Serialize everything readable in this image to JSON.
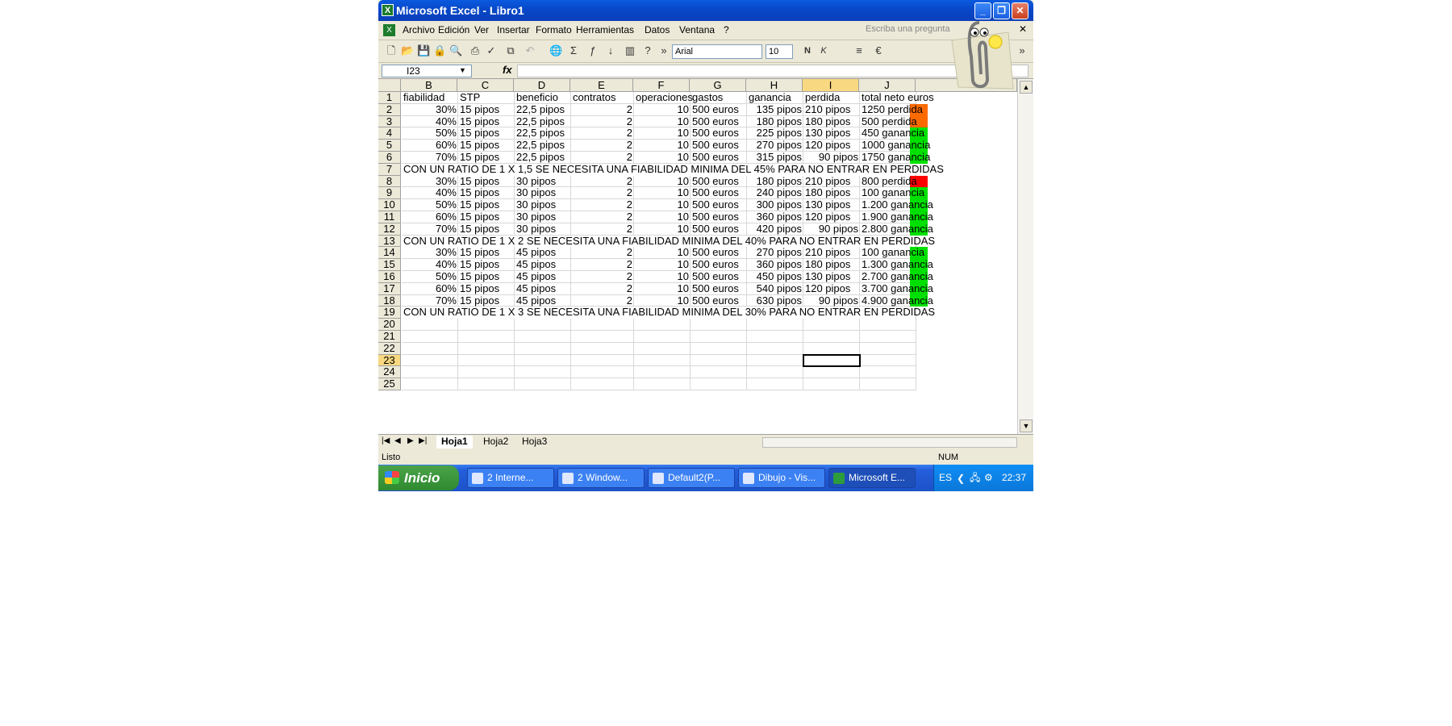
{
  "window": {
    "title": "Microsoft Excel - Libro1"
  },
  "menu": {
    "items": [
      "Archivo",
      "Edición",
      "Ver",
      "Insertar",
      "Formato",
      "Herramientas",
      "Datos",
      "Ventana",
      "?"
    ],
    "ask_placeholder": "Escriba una pregunta"
  },
  "toolbar": {
    "font": "Arial",
    "size": "10",
    "bold": "N",
    "italic": "K"
  },
  "formula": {
    "namebox": "I23",
    "fx": "fx"
  },
  "columns": [
    "B",
    "C",
    "D",
    "E",
    "F",
    "G",
    "H",
    "I",
    "J"
  ],
  "rows_numbers": [
    "1",
    "2",
    "3",
    "4",
    "5",
    "6",
    "7",
    "8",
    "9",
    "10",
    "11",
    "12",
    "13",
    "14",
    "15",
    "16",
    "17",
    "18",
    "19",
    "20",
    "21",
    "22",
    "23",
    "24",
    "25"
  ],
  "table": {
    "headers": [
      "fiabilidad",
      "STP",
      "beneficio",
      "contratos",
      "operaciones",
      "gastos",
      "ganancia",
      "perdida",
      "total neto euros"
    ],
    "rows": [
      [
        "30%",
        "15 pipos",
        "22,5 pipos",
        "2",
        "10",
        "500 euros",
        "135 pipos",
        "210 pipos",
        "1250  perdida"
      ],
      [
        "40%",
        "15 pipos",
        "22,5 pipos",
        "2",
        "10",
        "500 euros",
        "180 pipos",
        "180 pipos",
        "500   perdida"
      ],
      [
        "50%",
        "15 pipos",
        "22,5 pipos",
        "2",
        "10",
        "500 euros",
        "225 pipos",
        "130 pipos",
        "450 ganancia"
      ],
      [
        "60%",
        "15 pipos",
        "22,5 pipos",
        "2",
        "10",
        "500 euros",
        "270 pipos",
        "120 pipos",
        "1000 ganancia"
      ],
      [
        "70%",
        "15 pipos",
        "22,5 pipos",
        "2",
        "10",
        "500 euros",
        "315 pipos",
        "90 pipos",
        "1750 ganancia"
      ],
      [
        "30%",
        "15 pipos",
        "30 pipos",
        "2",
        "10",
        "500 euros",
        "180 pipos",
        "210 pipos",
        "800  perdida"
      ],
      [
        "40%",
        "15 pipos",
        "30 pipos",
        "2",
        "10",
        "500 euros",
        "240 pipos",
        "180 pipos",
        "100 ganancia"
      ],
      [
        "50%",
        "15 pipos",
        "30 pipos",
        "2",
        "10",
        "500 euros",
        "300 pipos",
        "130 pipos",
        "1.200 ganancia"
      ],
      [
        "60%",
        "15 pipos",
        "30 pipos",
        "2",
        "10",
        "500 euros",
        "360 pipos",
        "120 pipos",
        "1.900 ganancia"
      ],
      [
        "70%",
        "15 pipos",
        "30 pipos",
        "2",
        "10",
        "500 euros",
        "420 pipos",
        "90 pipos",
        "2.800 ganancia"
      ],
      [
        "30%",
        "15 pipos",
        "45 pipos",
        "2",
        "10",
        "500 euros",
        "270 pipos",
        "210 pipos",
        "100 ganancia"
      ],
      [
        "40%",
        "15 pipos",
        "45 pipos",
        "2",
        "10",
        "500 euros",
        "360 pipos",
        "180 pipos",
        "1.300 ganancia"
      ],
      [
        "50%",
        "15 pipos",
        "45 pipos",
        "2",
        "10",
        "500 euros",
        "450 pipos",
        "130 pipos",
        "2.700 ganancia"
      ],
      [
        "60%",
        "15 pipos",
        "45 pipos",
        "2",
        "10",
        "500 euros",
        "540 pipos",
        "120 pipos",
        "3.700 ganancia"
      ],
      [
        "70%",
        "15 pipos",
        "45 pipos",
        "2",
        "10",
        "500 euros",
        "630 pipos",
        "90 pipos",
        "4.900 ganancia"
      ]
    ],
    "notes": [
      "CON UN RATIO DE 1 X 1,5  SE NECESITA UNA FIABILIDAD MINIMA  DEL 45% PARA NO ENTRAR EN PERDIDAS",
      "CON UN RATIO DE 1  X  2   SE NECESITA UNA FIABILIDAD MINIMA DEL  40%  PARA NO ENTRAR EN PERDIDAS",
      "CON UN RATIO DE 1  X  3  SE NECESITA UNA FIABILIDAD  MINIMA DEL 30% PARA NO ENTRAR EN PERDIDAS"
    ],
    "status_colors": [
      "#ff6a00",
      "#ff6a00",
      "#00e000",
      "#00e000",
      "#00e000",
      "#ff0000",
      "#00e000",
      "#00e000",
      "#00e000",
      "#00e000",
      "#00e000",
      "#00e000",
      "#00e000",
      "#00e000",
      "#00e000"
    ]
  },
  "sheets": [
    "Hoja1",
    "Hoja2",
    "Hoja3"
  ],
  "status": {
    "left": "Listo",
    "num": "NUM"
  },
  "taskbar": {
    "start": "Inicio",
    "tasks": [
      "2 Interne...",
      "2 Window...",
      "Default2(P...",
      "Dibujo - Vis...",
      "Microsoft E..."
    ],
    "lang": "ES",
    "clock": "22:37"
  }
}
